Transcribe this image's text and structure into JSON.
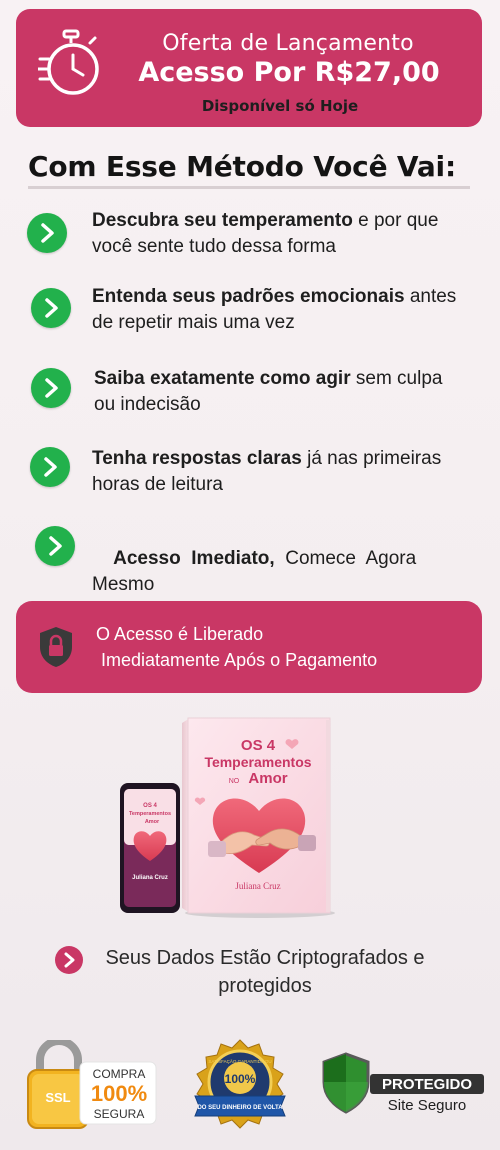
{
  "offer": {
    "line1": "Oferta de Lançamento",
    "line2": "Acesso Por R$27,00",
    "line3": "Disponível só Hoje",
    "icon": "stopwatch-icon"
  },
  "section_title": "Com Esse Método Você Vai:",
  "benefits": [
    {
      "bold": "Descubra seu temperamento",
      "rest1": " e por que",
      "rest2": "você sente tudo dessa forma"
    },
    {
      "bold": "Entenda seus padrões emocionais",
      "rest1": " antes",
      "rest2": "de repetir mais uma vez"
    },
    {
      "bold": "Saiba exatamente como agir",
      "rest1": " sem culpa",
      "rest2": "ou indecisão"
    },
    {
      "bold": "Tenha respostas claras",
      "rest1": " já nas primeiras",
      "rest2": "horas de leitura"
    },
    {
      "bold": "Acesso  Imediato,",
      "rest1": "  Comece  Agora",
      "rest2": "Mesmo"
    }
  ],
  "access": {
    "line1": "O Acesso é Liberado",
    "line2": " Imediatamente Após o Pagamento",
    "icon": "shield-lock-icon"
  },
  "product": {
    "book_title_1": "OS 4",
    "book_title_2": "Temperamentos",
    "book_title_3a": "NO",
    "book_title_3b": "Amor",
    "author": "Juliana Cruz",
    "phone_title_1": "OS 4",
    "phone_title_2": "Temperamentos",
    "phone_title_3": "Amor",
    "phone_author": "Juliana Cruz"
  },
  "secure_note": {
    "line1": "Seus Dados Estão Criptografados e",
    "line2": "protegidos"
  },
  "badges": {
    "ssl": {
      "lock_text": "SSL",
      "line1": "COMPRA",
      "line2": "100%",
      "line3": "SEGURA"
    },
    "guarantee": {
      "ring_top": "SATISFAÇÃO GARANTIDA OU",
      "center": "100%",
      "ribbon": "DO SEU DINHEIRO DE VOLTA"
    },
    "protected": {
      "label": "PROTEGIDO",
      "sub": "Site Seguro"
    }
  },
  "colors": {
    "brand": "#c93765",
    "check": "#22b14c",
    "text": "#1e1e1e"
  }
}
